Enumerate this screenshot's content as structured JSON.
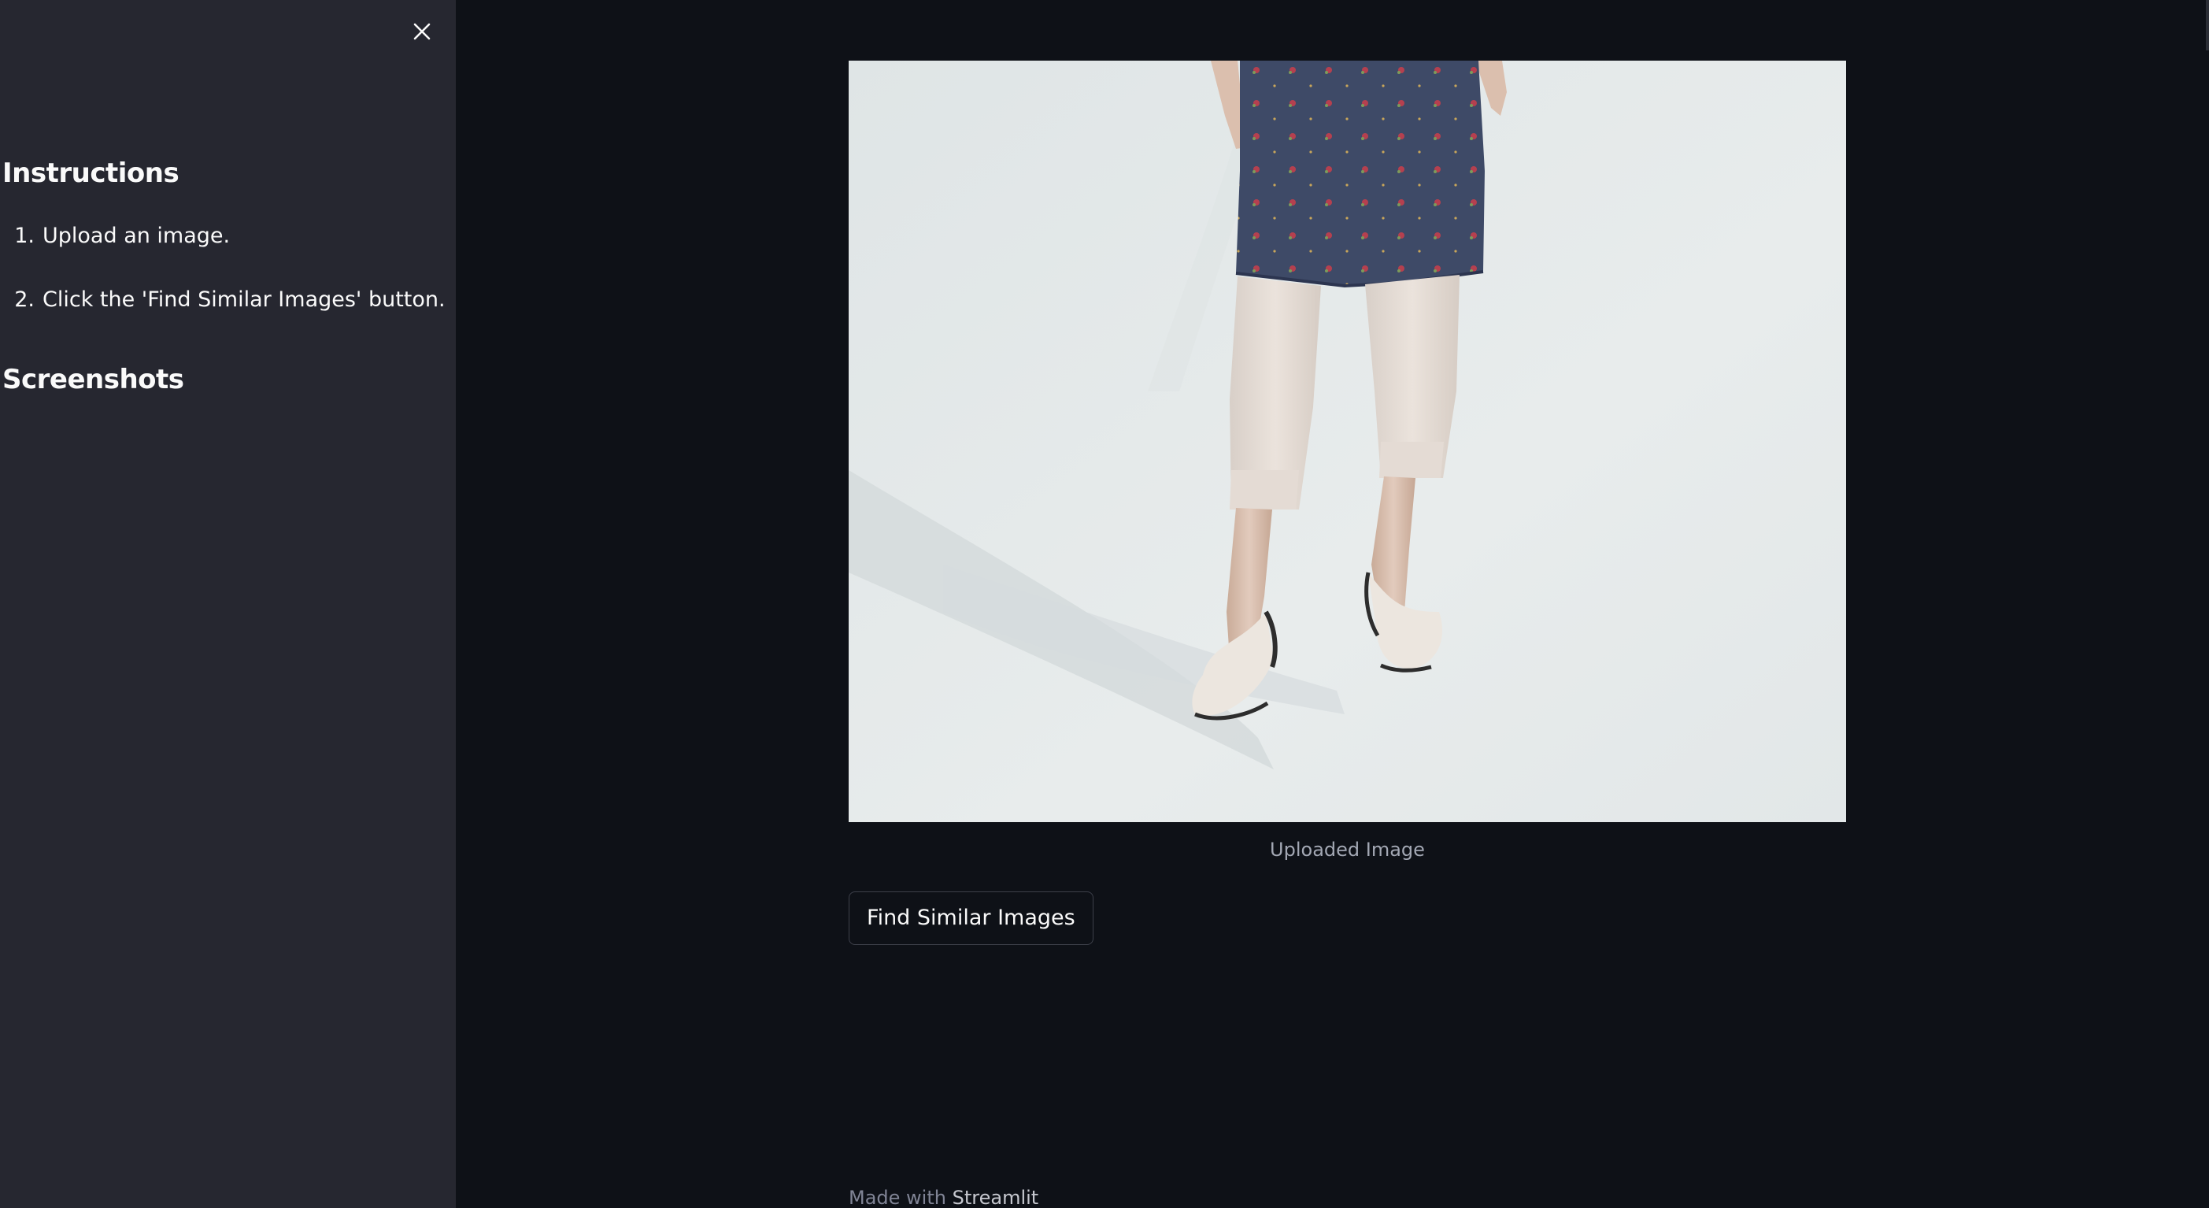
{
  "sidebar": {
    "close_icon": "close-icon",
    "instructions_heading": "Instructions",
    "instructions": [
      {
        "number": "1.",
        "text": "Upload an image."
      },
      {
        "number": "2.",
        "text": "Click the 'Find Similar Images' button."
      }
    ],
    "screenshots_heading": "Screenshots"
  },
  "main": {
    "image": {
      "caption": "Uploaded Image"
    },
    "find_button_label": "Find Similar Images",
    "footer": {
      "prefix": "Made with",
      "brand": "Streamlit"
    }
  },
  "colors": {
    "app_background": "#0e1117",
    "sidebar_background": "#262730",
    "text": "#fafafa",
    "caption_text": "#a3a8b4",
    "button_border": "#3d404a"
  }
}
